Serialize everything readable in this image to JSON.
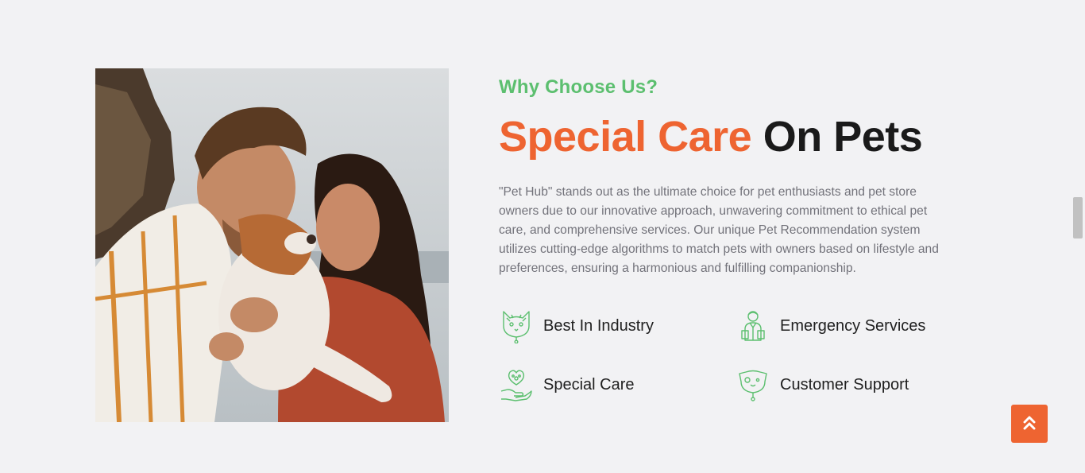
{
  "section": {
    "eyebrow": "Why Choose Us?",
    "headline_accent": "Special Care",
    "headline_rest": "On Pets",
    "description": "\"Pet Hub\" stands out as the ultimate choice for pet enthusiasts and pet store owners due to our innovative approach, unwavering commitment to ethical pet care, and comprehensive services. Our unique Pet Recommendation system utilizes cutting-edge algorithms to match pets with owners based on lifestyle and preferences, ensuring a harmonious and fulfilling companionship."
  },
  "features": [
    {
      "label": "Best In Industry",
      "icon": "cat-face-icon"
    },
    {
      "label": "Emergency Services",
      "icon": "veterinarian-icon"
    },
    {
      "label": "Special Care",
      "icon": "hand-heart-paw-icon"
    },
    {
      "label": "Customer Support",
      "icon": "dog-face-icon"
    }
  ],
  "colors": {
    "accent": "#ee6431",
    "green": "#5cbf6f",
    "background": "#f2f2f4",
    "text": "#1a1a1a",
    "muted": "#72727a"
  },
  "scroll_top": {
    "icon": "double-chevron-up-icon"
  }
}
